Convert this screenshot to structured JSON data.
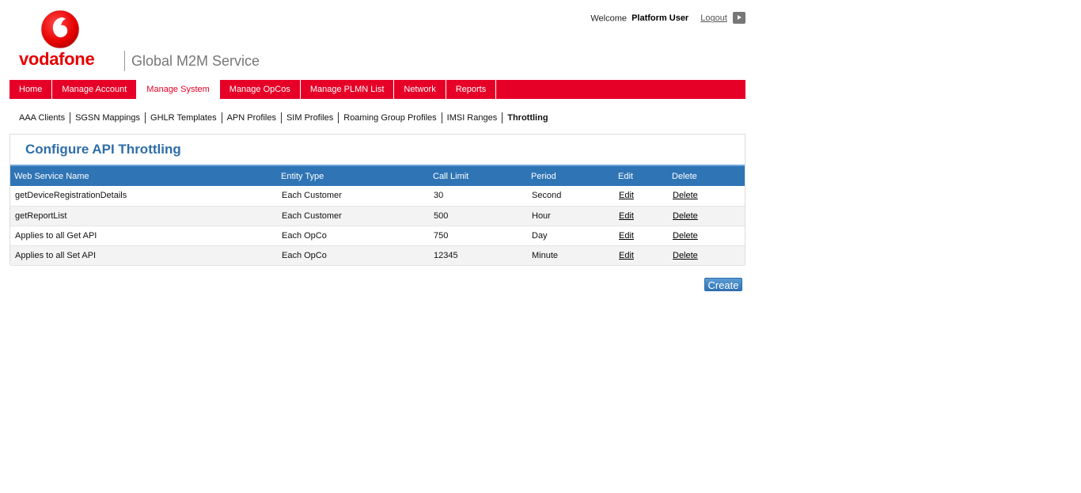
{
  "brand": {
    "logo_text": "vodafone",
    "service_name": "Global M2M Service",
    "logo_color": "#e60000"
  },
  "user": {
    "welcome": "Welcome",
    "name": "Platform User",
    "logout_label": "Logout"
  },
  "main_nav": {
    "items": [
      {
        "label": "Home"
      },
      {
        "label": "Manage Account"
      },
      {
        "label": "Manage System"
      },
      {
        "label": "Manage OpCos"
      },
      {
        "label": "Manage PLMN List"
      },
      {
        "label": "Network"
      },
      {
        "label": "Reports"
      }
    ],
    "active": "Manage System",
    "color": "#e60027"
  },
  "sub_nav": {
    "items": [
      {
        "label": "AAA Clients"
      },
      {
        "label": "SGSN Mappings"
      },
      {
        "label": "GHLR Templates"
      },
      {
        "label": "APN Profiles"
      },
      {
        "label": "SIM Profiles"
      },
      {
        "label": "Roaming Group Profiles"
      },
      {
        "label": "IMSI Ranges"
      },
      {
        "label": "Throttling"
      }
    ],
    "active": "Throttling"
  },
  "panel": {
    "title": "Configure API Throttling",
    "title_color": "#2e6ea8"
  },
  "table": {
    "headers": [
      "Web Service Name",
      "Entity Type",
      "Call Limit",
      "Period",
      "Edit",
      "Delete"
    ],
    "rows": [
      {
        "name": "getDeviceRegistrationDetails",
        "entity": "Each Customer",
        "limit": "30",
        "period": "Second",
        "edit": "Edit",
        "delete": "Delete"
      },
      {
        "name": "getReportList",
        "entity": "Each Customer",
        "limit": "500",
        "period": "Hour",
        "edit": "Edit",
        "delete": "Delete"
      },
      {
        "name": "Applies to all Get API",
        "entity": "Each OpCo",
        "limit": "750",
        "period": "Day",
        "edit": "Edit",
        "delete": "Delete"
      },
      {
        "name": "Applies to all Set API",
        "entity": "Each OpCo",
        "limit": "12345",
        "period": "Minute",
        "edit": "Edit",
        "delete": "Delete"
      }
    ],
    "header_color": "#2f74b5"
  },
  "actions": {
    "create_label": "Create"
  }
}
